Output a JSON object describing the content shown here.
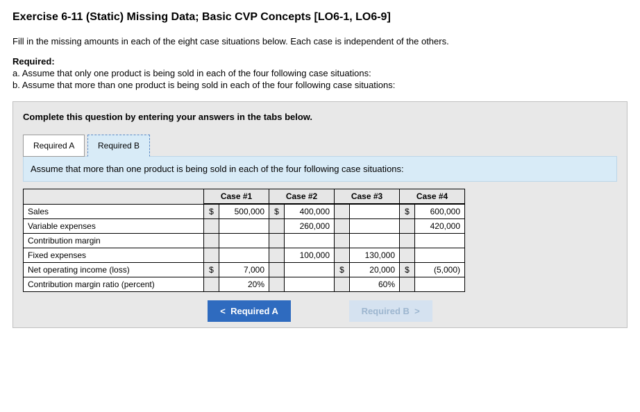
{
  "title": "Exercise 6-11 (Static) Missing Data; Basic CVP Concepts [LO6-1, LO6-9]",
  "intro": "Fill in the missing amounts in each of the eight case situations below. Each case is independent of the others.",
  "required_label": "Required:",
  "req_a": "a. Assume that only one product is being sold in each of the four following case situations:",
  "req_b": "b. Assume that more than one product is being sold in each of the four following case situations:",
  "instruct": "Complete this question by entering your answers in the tabs below.",
  "tabs": {
    "a": "Required A",
    "b": "Required B"
  },
  "assume": "Assume that more than one product is being sold in each of the four following case situations:",
  "headers": {
    "case1": "Case #1",
    "case2": "Case #2",
    "case3": "Case #3",
    "case4": "Case #4"
  },
  "rows": {
    "sales": "Sales",
    "varexp": "Variable expenses",
    "cm": "Contribution margin",
    "fixed": "Fixed expenses",
    "noi": "Net operating income (loss)",
    "cmr": "Contribution margin ratio (percent)"
  },
  "vals": {
    "dollar": "$",
    "c1_sales": "500,000",
    "c2_sales": "400,000",
    "c4_sales": "600,000",
    "c2_varexp": "260,000",
    "c4_varexp": "420,000",
    "c2_fixed": "100,000",
    "c3_fixed": "130,000",
    "c1_noi": "7,000",
    "c3_noi": "20,000",
    "c4_noi": "(5,000)",
    "c1_cmr": "20%",
    "c3_cmr": "60%"
  },
  "nav": {
    "prev": "Required A",
    "next": "Required B",
    "lt": "<",
    "gt": ">"
  }
}
